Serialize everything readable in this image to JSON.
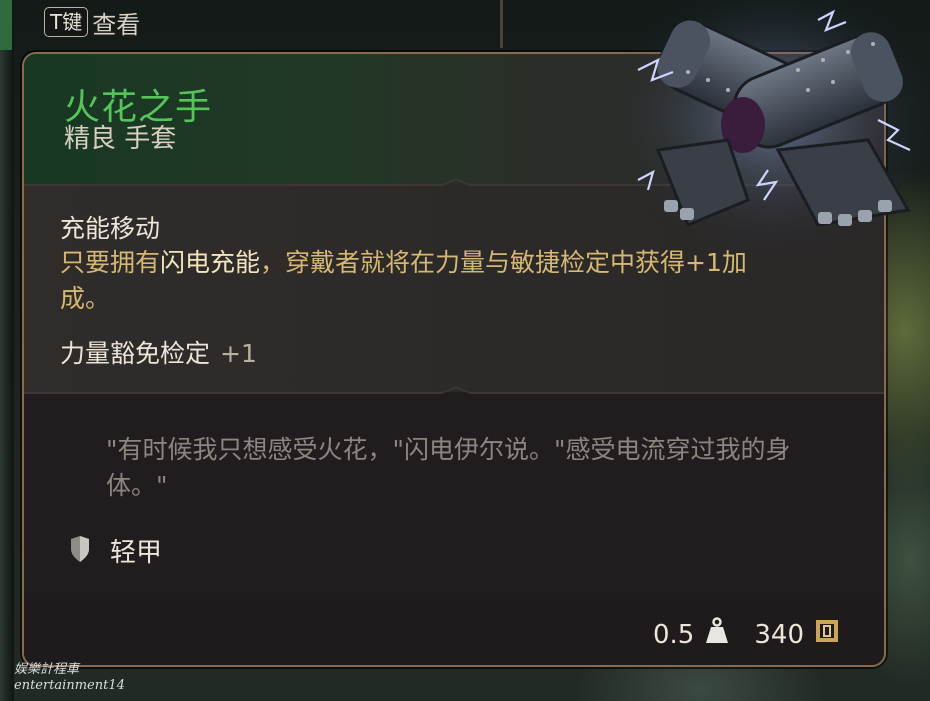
{
  "hint": {
    "key": "T键",
    "label": "查看"
  },
  "item": {
    "name": "火花之手",
    "subtitle": "精良 手套",
    "name_color": "#56c45a",
    "art_icon": "lightning-gloves-icon"
  },
  "perk": {
    "title": "充能移动",
    "desc_before": "只要拥有",
    "desc_highlight": "闪电充能",
    "desc_after": "，穿戴者就将在力量与敏捷检定中获得+1加成。"
  },
  "bonus": {
    "label": "力量豁免检定",
    "value": "+1"
  },
  "quote": "\"有时候我只想感受火花，\"闪电伊尔说。\"感受电流穿过我的身体。\"",
  "armor": {
    "icon": "shield-icon",
    "label": "轻甲"
  },
  "stats": {
    "weight": "0.5",
    "weight_icon": "weight-icon",
    "price": "340",
    "price_icon": "gold-coin-icon"
  },
  "watermark": {
    "line1": "娱樂計程車",
    "line2": "entertainment14"
  }
}
